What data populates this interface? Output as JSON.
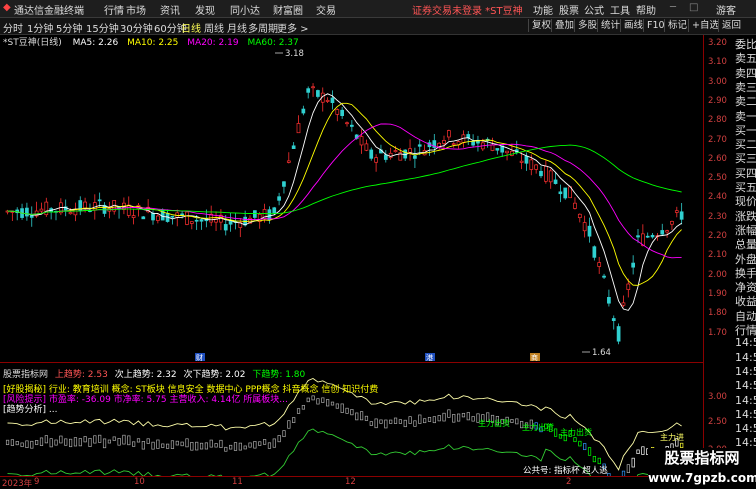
{
  "menubar": {
    "app_name": "通达信金融终端",
    "items": [
      "行情",
      "市场",
      "资讯",
      "发现",
      "同小达",
      "财富圈",
      "交易"
    ],
    "notice": "证券交易未登录 *ST豆神",
    "right_items": [
      "功能",
      "股票",
      "公式",
      "工具",
      "帮助"
    ],
    "guest": "游客"
  },
  "toolbar": {
    "periods": [
      "分时",
      "1分钟",
      "5分钟",
      "15分钟",
      "30分钟",
      "60分钟",
      "日线",
      "周线",
      "月线",
      "多周期",
      "更多 >"
    ],
    "active_period": "日线",
    "right_buttons": [
      "复权",
      "叠加",
      "多股",
      "统计",
      "画线",
      "F10",
      "标记",
      "+自选",
      "返回"
    ]
  },
  "main_chart": {
    "stock_title": "*ST豆神(日线)",
    "ma": [
      {
        "label": "MA5: 2.26",
        "color": "#ffffff"
      },
      {
        "label": "MA10: 2.25",
        "color": "#ffff00"
      },
      {
        "label": "MA20: 2.19",
        "color": "#ff00ff"
      },
      {
        "label": "MA60: 2.37",
        "color": "#00ff00"
      }
    ],
    "high_marker": "3.18",
    "low_marker": "1.64",
    "event_markers": [
      "财",
      "港",
      "商"
    ],
    "y_ticks": [
      "3.20",
      "3.10",
      "3.00",
      "2.90",
      "2.80",
      "2.70",
      "2.60",
      "2.50",
      "2.40",
      "2.30",
      "2.20",
      "2.10",
      "2.00",
      "1.90",
      "1.80",
      "1.70"
    ]
  },
  "indicator": {
    "name": "股票指标网",
    "values": [
      {
        "label": "上趋势: 2.53",
        "color": "#ff5555"
      },
      {
        "label": "次上趋势: 2.32",
        "color": "#ffffff"
      },
      {
        "label": "次下趋势: 2.02",
        "color": "#ffffff"
      },
      {
        "label": "下趋势: 1.80",
        "color": "#00ff00"
      }
    ],
    "legend_lines": [
      {
        "text": "[好股揭秘] 行业: 教育培训 概念: ST板块 信息安全 数据中心 PPP概念 抖音概念 信创 知识付费",
        "color": "#ffff00"
      },
      {
        "text": "[风险提示] 市盈率: -36.09 市净率: 5.75 主营收入: 4.14亿 所属板块...",
        "color": "#ff00ff"
      },
      {
        "text": "[趋势分析] ...",
        "color": "#ffffff"
      }
    ],
    "annotations": [
      "主力出货",
      "主力出货",
      "主力出货",
      "主力出货",
      "主力进",
      "公共号: 指标杯 超人逃"
    ],
    "y_ticks": [
      "3.00",
      "2.50",
      "2.00"
    ]
  },
  "date_axis": [
    "2023年",
    "9",
    "10",
    "11",
    "12",
    "2",
    "3"
  ],
  "right_panel": [
    "委比",
    "卖五",
    "卖四",
    "卖三",
    "卖二",
    "卖一",
    "买一",
    "买二",
    "买三",
    "买四",
    "买五",
    "现价",
    "涨跌",
    "涨幅",
    "总量",
    "外盘",
    "换手",
    "净资",
    "收益",
    "自动",
    "行情",
    "14:5",
    "14:5",
    "14:5",
    "14:5",
    "14:5",
    "14:5",
    "14:5",
    "14:5",
    "14:5"
  ],
  "watermark": {
    "line1": "股票指标网",
    "line2": "www.7gpzb.com"
  }
}
